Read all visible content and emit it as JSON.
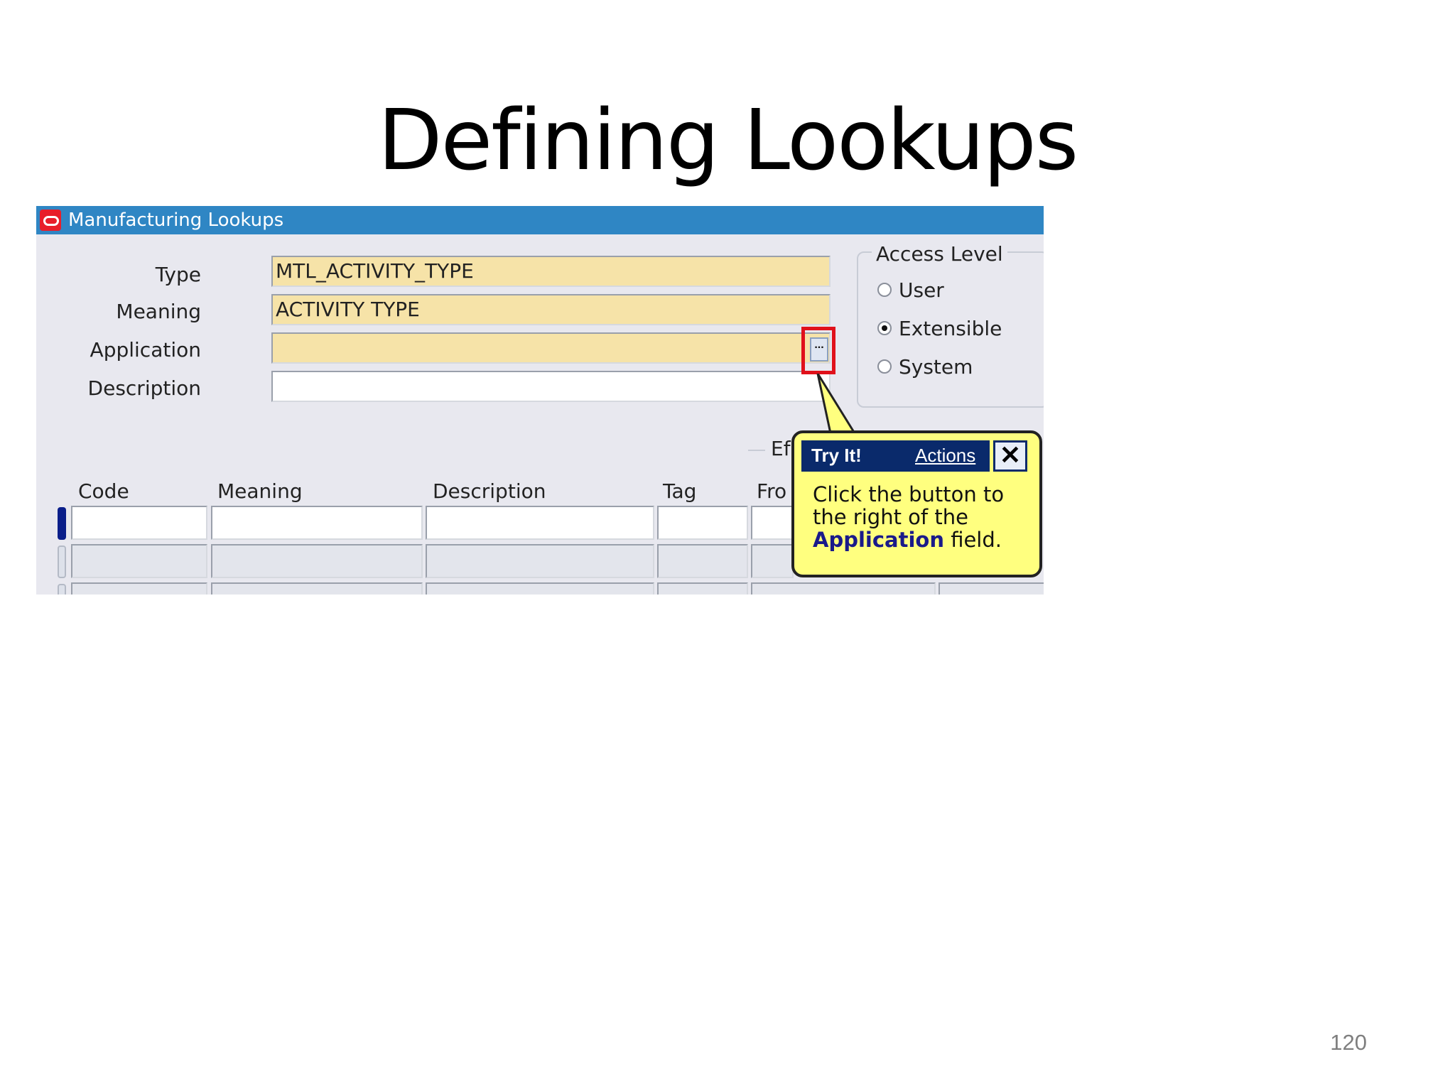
{
  "slide": {
    "title": "Defining Lookups",
    "page_number": "120"
  },
  "window": {
    "title": "Manufacturing Lookups"
  },
  "form": {
    "type_label": "Type",
    "type_value": "MTL_ACTIVITY_TYPE",
    "meaning_label": "Meaning",
    "meaning_value": "ACTIVITY TYPE",
    "application_label": "Application",
    "application_value": "",
    "description_label": "Description",
    "description_value": "",
    "lov_button_label": "..."
  },
  "access_level": {
    "title": "Access Level",
    "options": [
      {
        "label": "User",
        "selected": false
      },
      {
        "label": "Extensible",
        "selected": true
      },
      {
        "label": "System",
        "selected": false
      }
    ]
  },
  "effective_fragment": "Ef",
  "table": {
    "columns": [
      "Code",
      "Meaning",
      "Description",
      "Tag",
      "Fro"
    ]
  },
  "callout": {
    "title": "Try It!",
    "actions_label": "Actions",
    "close_label": "✕",
    "text_before": "Click the button to the right of the ",
    "text_bold": "Application",
    "text_after": " field."
  },
  "colors": {
    "titlebar": "#2f86c4",
    "required_field": "#f6e3a8",
    "callout_bg": "#ffff7f",
    "highlight_box": "#e0111b"
  }
}
